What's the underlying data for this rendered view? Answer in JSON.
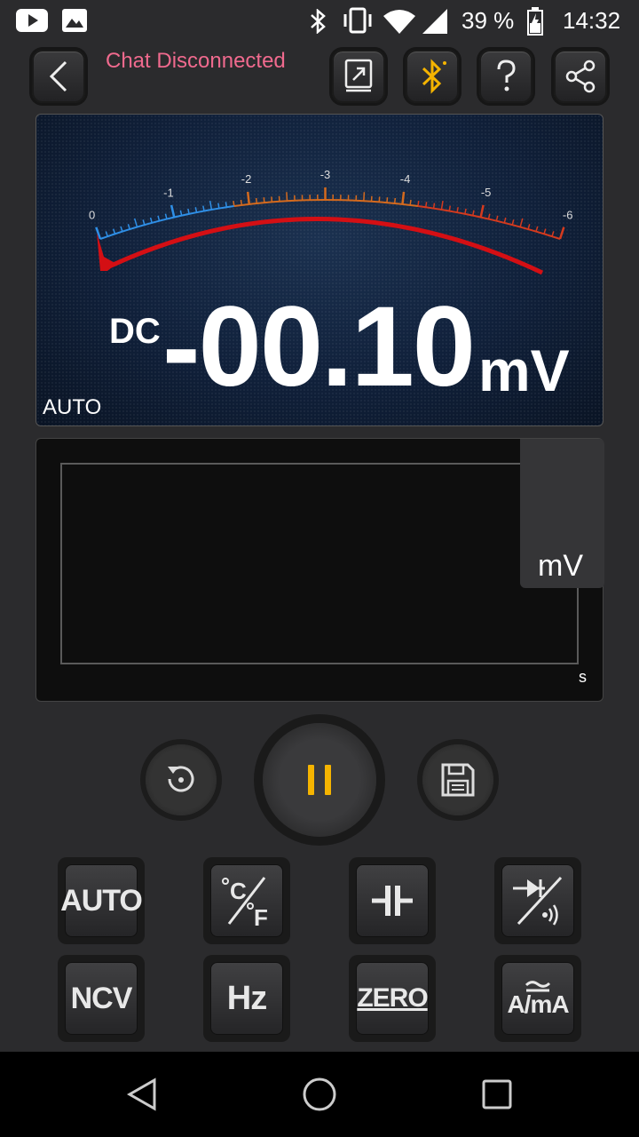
{
  "status_bar": {
    "icons": [
      "youtube-icon",
      "image-icon",
      "bluetooth-icon",
      "vibrate-icon",
      "wifi-icon",
      "signal-icon",
      "battery-icon"
    ],
    "battery": "39 %",
    "time": "14:32"
  },
  "header": {
    "chat_status": "Chat Disconnected",
    "buttons": [
      "back",
      "export",
      "bluetooth",
      "help",
      "share"
    ]
  },
  "meter": {
    "scale_labels": [
      "0",
      "-1",
      "-2",
      "-3",
      "-4",
      "-5",
      "-6"
    ],
    "mode": "DC",
    "reading": "-00.10",
    "unit": "mV",
    "range_mode": "AUTO",
    "needle_value": -0.1
  },
  "graph": {
    "y_unit": "mV",
    "x_unit": "s"
  },
  "controls": {
    "reset": "reset-icon",
    "pause": "pause-icon",
    "save": "save-icon"
  },
  "function_keys": [
    {
      "id": "auto",
      "label": "AUTO"
    },
    {
      "id": "temp",
      "label": "°C/°F"
    },
    {
      "id": "capacitance",
      "label": "capacitor-icon"
    },
    {
      "id": "diode",
      "label": "diode-continuity-icon"
    },
    {
      "id": "ncv",
      "label": "NCV"
    },
    {
      "id": "hz",
      "label": "Hz"
    },
    {
      "id": "zero",
      "label": "ZERO"
    },
    {
      "id": "current",
      "label": "A/mA"
    }
  ],
  "colors": {
    "accent_pink": "#f06a8e",
    "accent_yellow": "#f5b400",
    "meter_blue": "#2f8fe6",
    "meter_orange": "#d46a1e",
    "meter_red": "#d40f14"
  },
  "nav": [
    "back-icon",
    "home-icon",
    "recents-icon"
  ]
}
